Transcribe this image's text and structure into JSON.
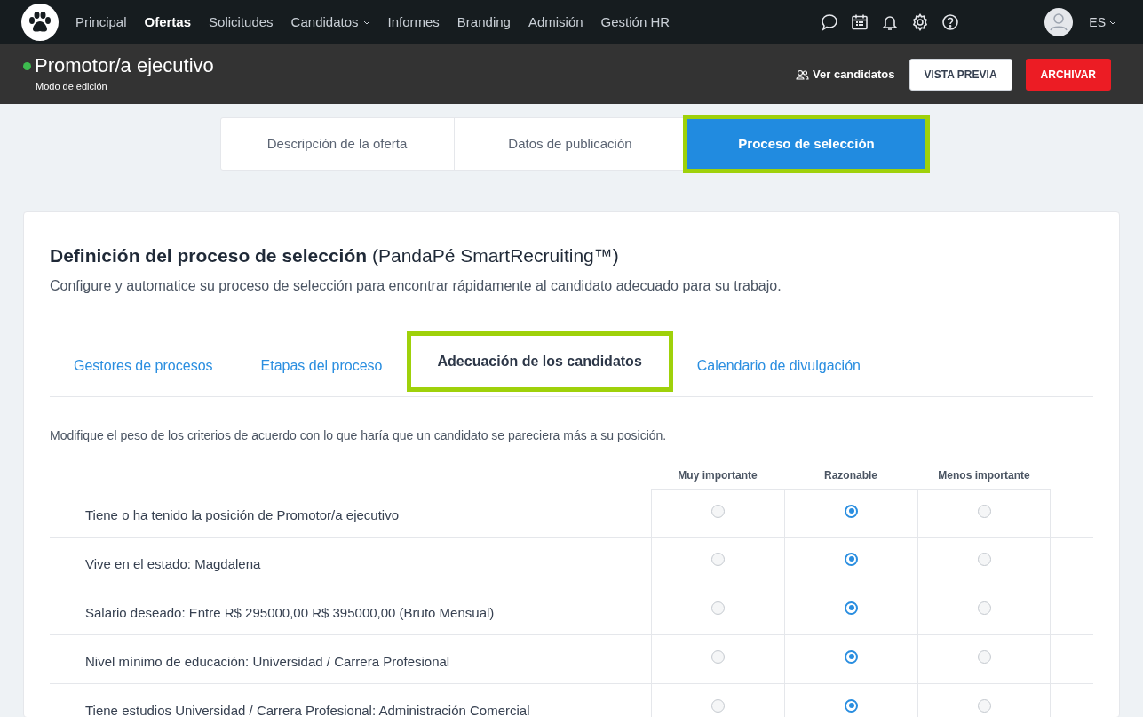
{
  "nav": {
    "items": [
      {
        "label": "Principal",
        "selected": false,
        "dropdown": false
      },
      {
        "label": "Ofertas",
        "selected": true,
        "dropdown": false
      },
      {
        "label": "Solicitudes",
        "selected": false,
        "dropdown": false
      },
      {
        "label": "Candidatos",
        "selected": false,
        "dropdown": true
      },
      {
        "label": "Informes",
        "selected": false,
        "dropdown": false
      },
      {
        "label": "Branding",
        "selected": false,
        "dropdown": false
      },
      {
        "label": "Admisión",
        "selected": false,
        "dropdown": false
      },
      {
        "label": "Gestión HR",
        "selected": false,
        "dropdown": false
      }
    ],
    "language": "ES"
  },
  "header": {
    "title": "Promotor/a ejecutivo",
    "active": true,
    "subtitle": "Modo de edición",
    "link": "Ver candidatos",
    "buttons": [
      "VISTA PREVIA",
      "ARCHIVAR"
    ]
  },
  "main_tabs": [
    {
      "label": "Descripción de la oferta",
      "selected": false,
      "highlighted": false
    },
    {
      "label": "Datos de publicación",
      "selected": false,
      "highlighted": false
    },
    {
      "label": "Proceso de selección",
      "selected": true,
      "highlighted": true
    }
  ],
  "card": {
    "title": "Definición del proceso de selección",
    "title_suffix": "(PandaPé SmartRecruiting™)",
    "description": "Configure y automatice su proceso de selección para encontrar rápidamente al candidato adecuado para su trabajo.",
    "tabs": [
      {
        "label": "Gestores de procesos",
        "selected": false,
        "highlighted": false
      },
      {
        "label": "Etapas del proceso",
        "selected": false,
        "highlighted": false
      },
      {
        "label": "Adecuación de los candidatos",
        "selected": true,
        "highlighted": true
      },
      {
        "label": "Calendario de divulgación",
        "selected": false,
        "highlighted": false
      }
    ],
    "instructions": "Modifique el peso de los criterios de acuerdo con lo que haría que un candidato se pareciera más a su posición.",
    "columns": [
      "Muy importante",
      "Razonable",
      "Menos importante"
    ],
    "rows": [
      {
        "label": "Tiene o ha tenido la posición de Promotor/a ejecutivo",
        "options": [
          {
            "selected": false
          },
          {
            "selected": true
          },
          {
            "selected": false
          }
        ]
      },
      {
        "label": "Vive en el estado: Magdalena",
        "options": [
          {
            "selected": false
          },
          {
            "selected": true
          },
          {
            "selected": false
          }
        ]
      },
      {
        "label": "Salario deseado: Entre R$ 295000,00 R$ 395000,00 (Bruto Mensual)",
        "options": [
          {
            "selected": false
          },
          {
            "selected": true
          },
          {
            "selected": false
          }
        ]
      },
      {
        "label": "Nivel mínimo de educación: Universidad / Carrera Profesional",
        "options": [
          {
            "selected": false
          },
          {
            "selected": true
          },
          {
            "selected": false
          }
        ]
      },
      {
        "label": "Tiene estudios Universidad / Carrera Profesional: Administración Comercial",
        "options": [
          {
            "selected": false
          },
          {
            "selected": true
          },
          {
            "selected": false
          }
        ]
      }
    ]
  }
}
